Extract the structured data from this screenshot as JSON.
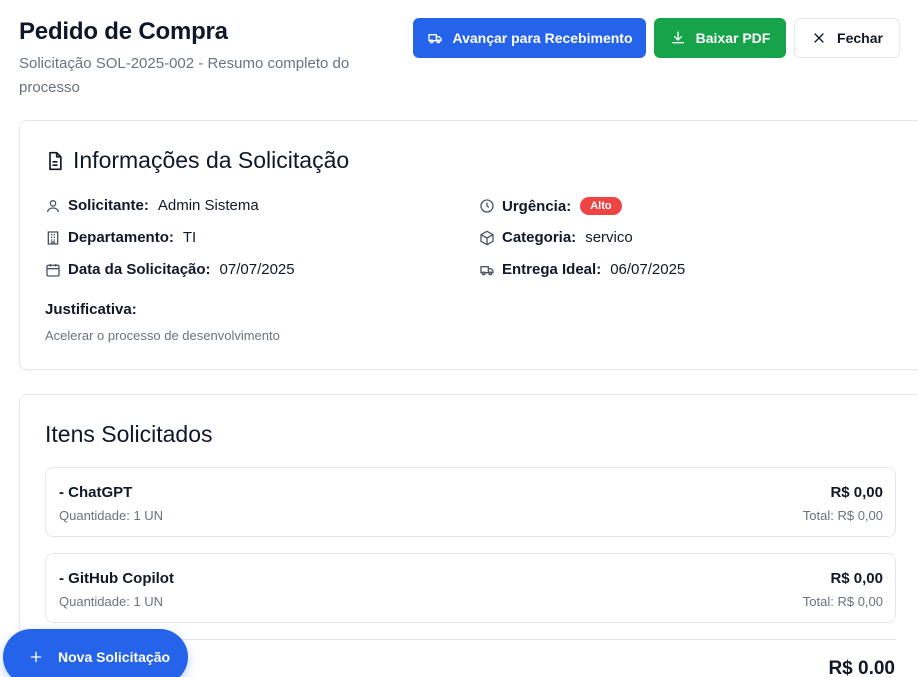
{
  "header": {
    "title": "Pedido de Compra",
    "subtitle": "Solicitação SOL-2025-002 - Resumo completo do processo"
  },
  "actions": {
    "advance_label": "Avançar para Recebimento",
    "pdf_label": "Baixar PDF",
    "close_label": "Fechar"
  },
  "info": {
    "title": "Informações da Solicitação",
    "requester_label": "Solicitante:",
    "requester_value": "Admin Sistema",
    "department_label": "Departamento:",
    "department_value": "TI",
    "date_label": "Data da Solicitação:",
    "date_value": "07/07/2025",
    "urgency_label": "Urgência:",
    "urgency_value": "Alto",
    "category_label": "Categoria:",
    "category_value": "servico",
    "delivery_label": "Entrega Ideal:",
    "delivery_value": "06/07/2025",
    "justification_label": "Justificativa:",
    "justification_text": "Acelerar o processo de desenvolvimento"
  },
  "items": {
    "title": "Itens Solicitados",
    "list": [
      {
        "name": "- ChatGPT",
        "quantity": "Quantidade: 1 UN",
        "price": "R$ 0,00",
        "total": "Total: R$ 0,00"
      },
      {
        "name": "- GitHub Copilot",
        "quantity": "Quantidade: 1 UN",
        "price": "R$ 0,00",
        "total": "Total: R$ 0,00"
      }
    ],
    "grand_total": "R$ 0.00"
  },
  "fab": {
    "label": "Nova Solicitação"
  },
  "colors": {
    "primary": "#2563eb",
    "success": "#16a34a",
    "danger": "#ef4444",
    "muted": "#6b7280"
  }
}
